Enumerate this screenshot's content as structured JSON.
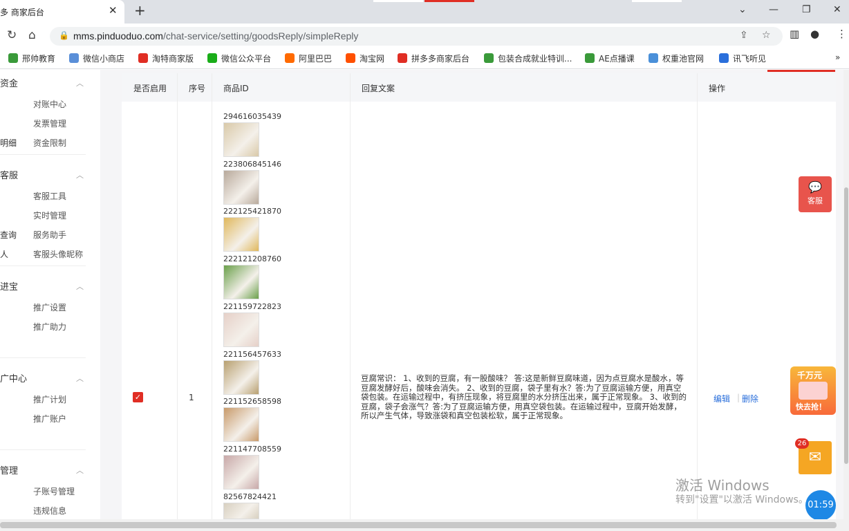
{
  "browser": {
    "tab_title": "多 商家后台",
    "tab_close": "✕",
    "new_tab": "+",
    "url_domain": "mms.pinduoduo.com",
    "url_path": "/chat-service/setting/goodsReply/simpleReply"
  },
  "bookmarks": [
    {
      "label": "邢帅教育",
      "color": "#3a9a3a"
    },
    {
      "label": "微信小商店",
      "color": "#5a8fd8"
    },
    {
      "label": "淘特商家版",
      "color": "#e02e24"
    },
    {
      "label": "微信公众平台",
      "color": "#1aad19"
    },
    {
      "label": "阿里巴巴",
      "color": "#ff6a00"
    },
    {
      "label": "淘宝网",
      "color": "#ff5000"
    },
    {
      "label": "拼多多商家后台",
      "color": "#e02e24"
    },
    {
      "label": "包装合成就业特训...",
      "color": "#3a9a3a"
    },
    {
      "label": "AE点播课",
      "color": "#3a9a3a"
    },
    {
      "label": "权重池官网",
      "color": "#4a90d9"
    },
    {
      "label": "讯飞听见",
      "color": "#2a6fdb"
    }
  ],
  "sidebar": {
    "sections": [
      {
        "title": "资金",
        "items": [
          {
            "prefix": "",
            "label": "对账中心"
          },
          {
            "prefix": "",
            "label": "发票管理"
          },
          {
            "prefix": "明细",
            "label": "资金限制"
          }
        ]
      },
      {
        "title": "客服",
        "items": [
          {
            "prefix": "",
            "label": "客服工具"
          },
          {
            "prefix": "",
            "label": "实时管理"
          },
          {
            "prefix": "查询",
            "label": "服务助手"
          },
          {
            "prefix": "人",
            "label": "客服头像昵称"
          }
        ]
      },
      {
        "title": "进宝",
        "items": [
          {
            "prefix": "",
            "label": "推广设置"
          },
          {
            "prefix": "",
            "label": "推广助力"
          }
        ]
      },
      {
        "title": "广中心",
        "items": [
          {
            "prefix": "",
            "label": "推广计划"
          },
          {
            "prefix": "",
            "label": "推广账户"
          }
        ]
      },
      {
        "title": "管理",
        "items": [
          {
            "prefix": "",
            "label": "子账号管理"
          },
          {
            "prefix": "",
            "label": "违规信息"
          }
        ]
      }
    ]
  },
  "table": {
    "headers": [
      "是否启用",
      "序号",
      "商品ID",
      "回复文案",
      "操作"
    ],
    "row": {
      "seq": "1",
      "enabled": true,
      "goods": [
        {
          "id": "294616035439",
          "color": "#d9c9a8"
        },
        {
          "id": "223806845146",
          "color": "#b8a99b"
        },
        {
          "id": "222125421870",
          "color": "#e0b85c"
        },
        {
          "id": "222121208760",
          "color": "#6aa04a"
        },
        {
          "id": "221159722823",
          "color": "#e6d0c8"
        },
        {
          "id": "221156457633",
          "color": "#b8a070"
        },
        {
          "id": "221152658598",
          "color": "#c89a6a"
        },
        {
          "id": "221147708559",
          "color": "#c8a8a8"
        },
        {
          "id": "82567824421",
          "color": "#d8d0c0"
        }
      ],
      "reply_text": "豆腐常识： 1、收到的豆腐，有一股酸味？ 答:这是新鲜豆腐味道，因为点豆腐水是酸水，等豆腐发酵好后，酸味会消失。 2、收到的豆腐，袋子里有水？答:为了豆腐运输方便，用真空袋包装。在运输过程中，有挤压现象，将豆腐里的水分挤压出来，属于正常现象。 3、收到的豆腐，袋子会涨气？答:为了豆腐运输方便，用真空袋包装。在运输过程中，豆腐开始发酵，所以产生气体，导致涨袋和真空包装松软，属于正常现象。",
      "actions": {
        "edit": "编辑",
        "delete": "删除"
      }
    }
  },
  "floating": {
    "kefu_label": "客服",
    "promo_top": "千万元",
    "promo_bottom": "快去抢！",
    "mail_badge": "26",
    "timer": "01:59"
  },
  "watermark": {
    "line1": "激活 Windows",
    "line2": "转到\"设置\"以激活 Windows。"
  }
}
